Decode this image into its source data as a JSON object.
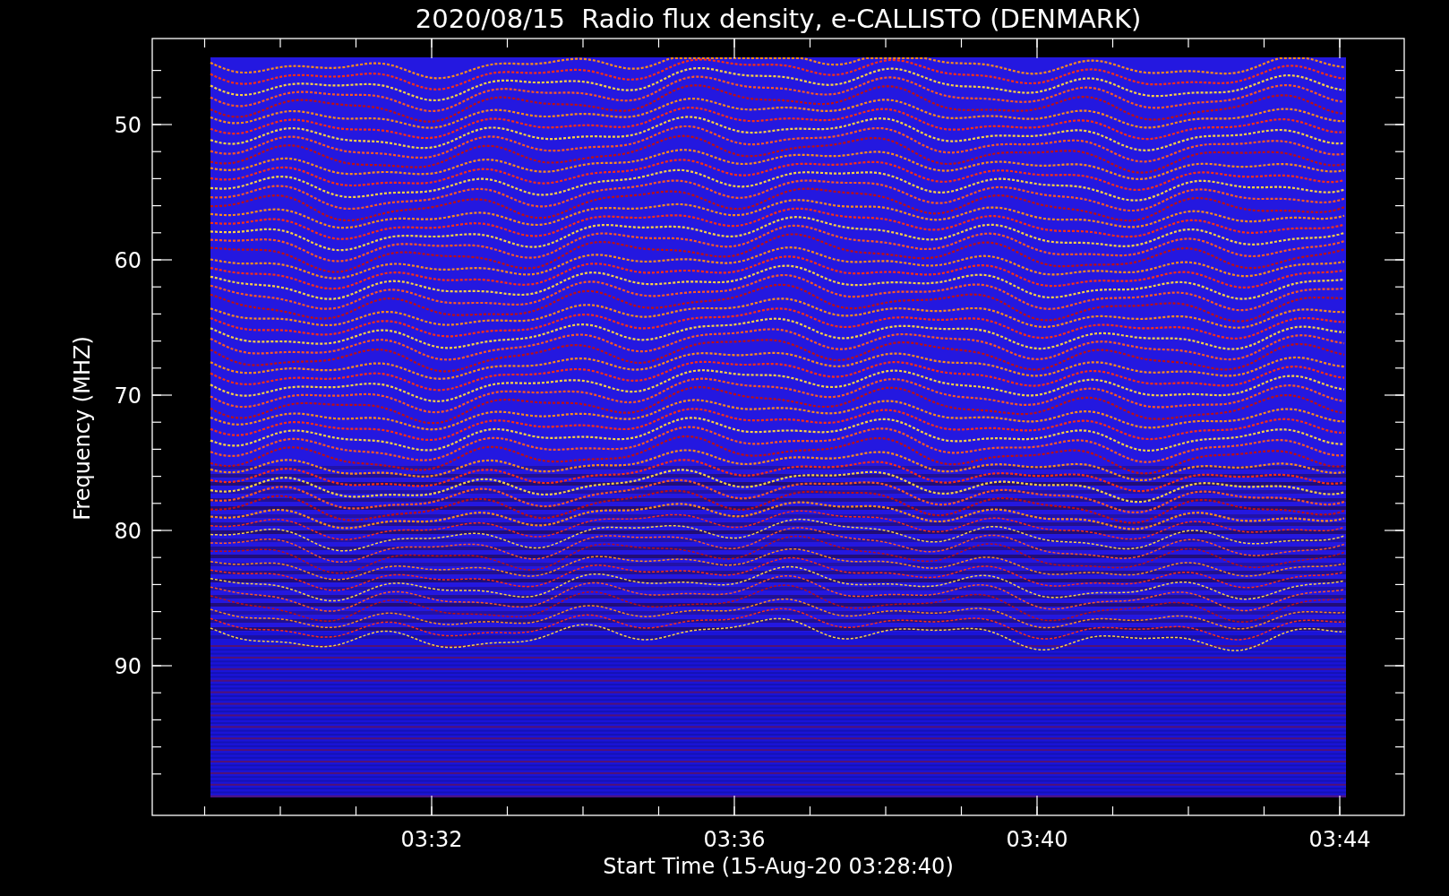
{
  "title": "2020/08/15  Radio flux density, e-CALLISTO (DENMARK)",
  "chart": {
    "ylabel": "Frequency (MHZ)",
    "xlabel": "Start Time (15-Aug-20 03:28:40)",
    "yticks": [
      "50",
      "60",
      "70",
      "80",
      "90"
    ],
    "xticks": [
      "03:32",
      "03:36",
      "03:40",
      "03:44"
    ]
  }
}
